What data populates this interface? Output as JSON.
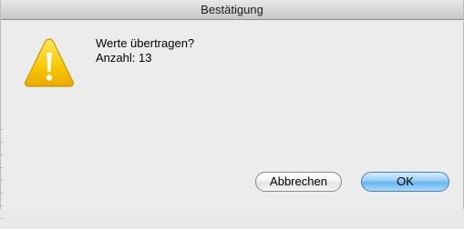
{
  "window": {
    "title": "Bestätigung"
  },
  "message": {
    "line1": "Werte übertragen?",
    "line2": "Anzahl: 13"
  },
  "icon": {
    "name": "warning-icon",
    "color": "#f5c400"
  },
  "buttons": {
    "cancel_label": "Abbrechen",
    "ok_label": "OK",
    "default_color": "#6cb5ef"
  }
}
